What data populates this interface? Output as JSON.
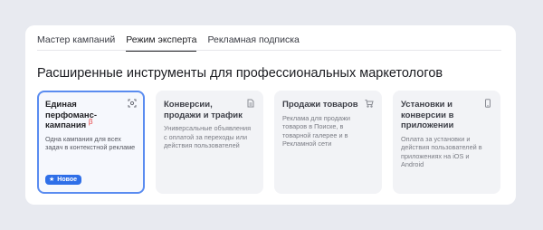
{
  "tabs": [
    {
      "label": "Мастер кампаний",
      "active": false
    },
    {
      "label": "Режим эксперта",
      "active": true
    },
    {
      "label": "Рекламная подписка",
      "active": false
    }
  ],
  "heading": "Расширенные инструменты для профессиональных маркетологов",
  "cards": [
    {
      "title": "Единая перфоманс-кампания",
      "beta": "β",
      "description": "Одна кампания для всех задач в контекстной рекламе",
      "icon": "target-scan-icon",
      "badge": {
        "icon": "star-icon",
        "label": "Новое"
      },
      "selected": true
    },
    {
      "title": "Конверсии, продажи и трафик",
      "description": "Универсальные объявления с оплатой за переходы или действия пользователей",
      "icon": "document-icon",
      "selected": false
    },
    {
      "title": "Продажи товаров",
      "description": "Реклама для продажи товаров в Поиске, в товарной галерее и в Рекламной сети",
      "icon": "cart-icon",
      "selected": false
    },
    {
      "title": "Установки и конверсии в приложении",
      "description": "Оплата за установки и действия пользователей в приложениях на iOS и Android",
      "icon": "phone-icon",
      "selected": false
    }
  ],
  "colors": {
    "accent": "#2f6fe8",
    "selected_border": "#5a8cf0",
    "beta": "#e53b3b",
    "page_bg": "#e8eaf0",
    "card_bg": "#f2f3f6"
  }
}
